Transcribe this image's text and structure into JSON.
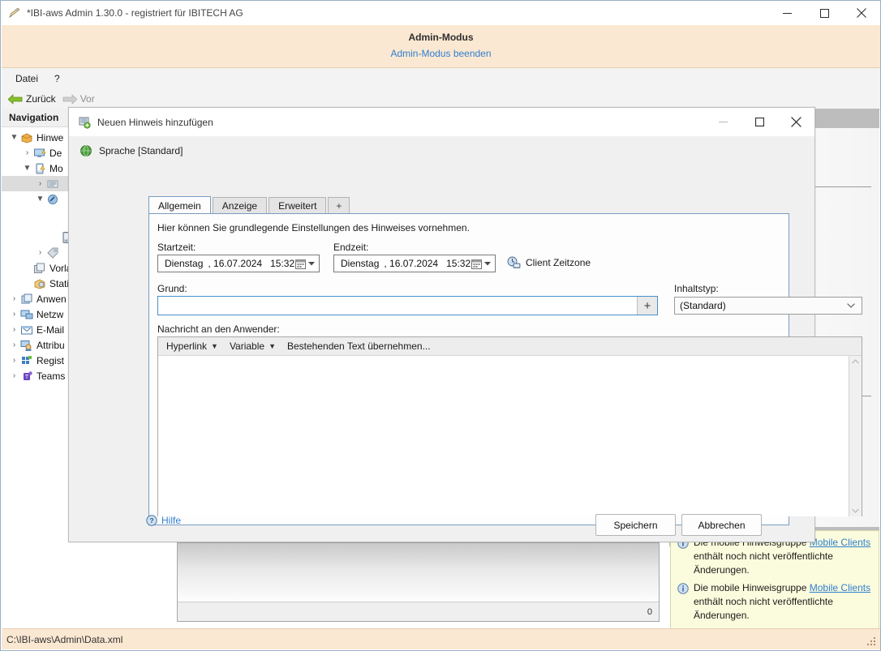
{
  "window": {
    "title": "*IBI-aws Admin 1.30.0 - registriert für IBITECH AG",
    "icon": "pencil-icon",
    "minimize": "−",
    "maximize": "□",
    "close": "✕"
  },
  "admin_banner": {
    "title": "Admin-Modus",
    "link": "Admin-Modus beenden",
    "link_color": "#2f7fd0",
    "background": "#fbe8d2"
  },
  "menu": {
    "items": [
      {
        "label": "Datei"
      },
      {
        "label": "?"
      }
    ]
  },
  "nav_toolbar": {
    "back": "Zurück",
    "forward": "Vor"
  },
  "sidebar": {
    "header": "Navigation",
    "items": [
      {
        "label": "Hinwe",
        "icon": "box-icon",
        "indent": 0,
        "expander": "▼",
        "selected": false
      },
      {
        "label": "De",
        "icon": "monitor-warning-icon",
        "indent": 1,
        "expander": "›",
        "selected": false
      },
      {
        "label": "Mo",
        "icon": "mobile-warning-icon",
        "indent": 1,
        "expander": "▼",
        "selected": false
      },
      {
        "label": "",
        "icon": "list-icon",
        "indent": 2,
        "expander": "›",
        "selected": true
      },
      {
        "label": "",
        "icon": "wrench-icon",
        "indent": 2,
        "expander": "▼",
        "selected": false
      },
      {
        "label": "",
        "icon": "phone-icon",
        "indent": 3,
        "expander": "",
        "selected": false
      },
      {
        "label": "",
        "icon": "tag-icon",
        "indent": 2,
        "expander": "›",
        "selected": false
      },
      {
        "label": "Vorlag",
        "icon": "templates-icon",
        "indent": 1,
        "expander": "",
        "selected": false
      },
      {
        "label": "Statisc",
        "icon": "statistics-icon",
        "indent": 1,
        "expander": "",
        "selected": false
      },
      {
        "label": "Anwen",
        "icon": "applications-icon",
        "indent": 0,
        "expander": "›",
        "selected": false
      },
      {
        "label": "Netzw",
        "icon": "network-icon",
        "indent": 0,
        "expander": "›",
        "selected": false
      },
      {
        "label": "E-Mail",
        "icon": "email-icon",
        "indent": 0,
        "expander": "›",
        "selected": false
      },
      {
        "label": "Attribu",
        "icon": "attributes-icon",
        "indent": 0,
        "expander": "›",
        "selected": false
      },
      {
        "label": "Regist",
        "icon": "registry-icon",
        "indent": 0,
        "expander": "›",
        "selected": false
      },
      {
        "label": "Teams",
        "icon": "teams-icon",
        "indent": 0,
        "expander": "›",
        "selected": false
      }
    ]
  },
  "center": {
    "grid_footer_count": "0"
  },
  "right_panel": {
    "notices": [
      {
        "text_before": "Die mobile Hinweisgruppe ",
        "link": "Mobile Clients",
        "text_after": " enthält noch nicht veröffentlichte Änderungen."
      },
      {
        "text_before": "Die mobile Hinweisgruppe ",
        "link": "Mobile Clients",
        "text_after": " enthält noch nicht veröffentlichte Änderungen."
      }
    ]
  },
  "statusbar": {
    "path": "C:\\IBI-aws\\Admin\\Data.xml"
  },
  "dialog": {
    "title": "Neuen Hinweis hinzufügen",
    "icon": "add-note-icon",
    "minimize": "−",
    "maximize": "□",
    "close": "✕",
    "language": "Sprache [Standard]",
    "tabs": [
      {
        "label": "Allgemein",
        "active": true
      },
      {
        "label": "Anzeige",
        "active": false
      },
      {
        "label": "Erweitert",
        "active": false
      },
      {
        "label": "+",
        "active": false
      }
    ],
    "description": "Hier können Sie grundlegende Einstellungen des Hinweises vornehmen.",
    "start": {
      "label": "Startzeit:",
      "day": "Dienstag",
      "date": ", 16.07.2024",
      "time": "15:32"
    },
    "end": {
      "label": "Endzeit:",
      "day": "Dienstag",
      "date": ", 16.07.2024",
      "time": "15:32"
    },
    "timezone": "Client Zeitzone",
    "reason": {
      "label": "Grund:",
      "value": "",
      "placeholder": "",
      "add_button": "+"
    },
    "content_type": {
      "label": "Inhaltstyp:",
      "value": "(Standard)"
    },
    "message": {
      "label": "Nachricht an den Anwender:",
      "toolbar": [
        {
          "label": "Hyperlink",
          "caret": "▼"
        },
        {
          "label": "Variable",
          "caret": "▼"
        },
        {
          "label": "Bestehenden Text übernehmen...",
          "caret": ""
        }
      ],
      "body": ""
    },
    "help": "Hilfe",
    "save": "Speichern",
    "cancel": "Abbrechen"
  }
}
